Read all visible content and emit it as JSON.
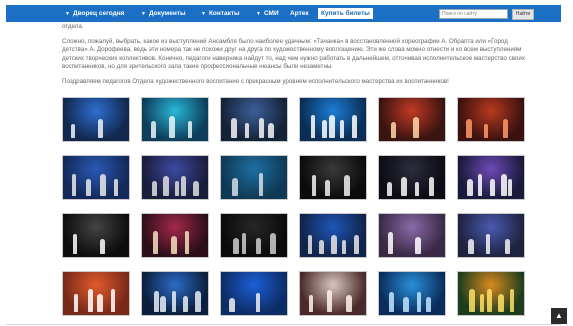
{
  "nav": {
    "items": [
      {
        "label": "Дворец сегодня",
        "has_arrow": true
      },
      {
        "label": "Документы",
        "has_arrow": true
      },
      {
        "label": "Контакты",
        "has_arrow": true
      },
      {
        "label": "СМИ",
        "has_arrow": true
      },
      {
        "label": "Артек",
        "has_arrow": false
      }
    ],
    "buy_button": "Купить билеты",
    "search_placeholder": "Поиск по сайту",
    "search_button": "Найти"
  },
  "article": {
    "p0": "отдела.",
    "p1": "Сложно, пожалуй, выбрать, какое из выступлений Ансамбля было наиболее удачным: «Тачанка» в восстановленной хореографии А. Обрапта или «Город детства» А. Дорофеева, ведь эти номера так не похожи друг на друга по художественному воплощению. Эти же слова можно отнести и ко всем выступлениям детских творческих коллективов. Конечно, педагоги наверняка найдут то, над чем нужно работать в дальнейшем, отточивая исполнительское мастерство своих воспитанников, но для зрительского зала такие профессиональные нюансы были незаметны.",
    "p2": "Поздравляем педагогов Отдела художественного воспитания с прекрасным уровнем исполнительского мастерства их воспитанников!"
  },
  "gallery": {
    "photos": [
      {
        "bg": "#12284f",
        "accent": "#2f6fd1",
        "fig": "#f0f3fa"
      },
      {
        "bg": "#0d3e5c",
        "accent": "#2ab7d6",
        "fig": "#eaf4f8"
      },
      {
        "bg": "#142238",
        "accent": "#3d5f99",
        "fig": "#f5f5f5"
      },
      {
        "bg": "#0a2e56",
        "accent": "#1c7ed6",
        "fig": "#ffffff"
      },
      {
        "bg": "#3a1410",
        "accent": "#c23a25",
        "fig": "#ffd9a8"
      },
      {
        "bg": "#3b120f",
        "accent": "#b8391f",
        "fig": "#ff9a66"
      },
      {
        "bg": "#14295a",
        "accent": "#2a59b5",
        "fig": "#e9e9e9"
      },
      {
        "bg": "#1a1d3c",
        "accent": "#3e4aa1",
        "fig": "#e0e0e0"
      },
      {
        "bg": "#0f3a55",
        "accent": "#1e6fa3",
        "fig": "#d7dde6"
      },
      {
        "bg": "#0b0b0b",
        "accent": "#3a3a3a",
        "fig": "#f2f2f2"
      },
      {
        "bg": "#0c0c14",
        "accent": "#2d2d3d",
        "fig": "#fafafa"
      },
      {
        "bg": "#1a1a3a",
        "accent": "#6e4ab8",
        "fig": "#ffffff"
      },
      {
        "bg": "#0d0d0d",
        "accent": "#444444",
        "fig": "#ffffff"
      },
      {
        "bg": "#2d0f1a",
        "accent": "#a3284a",
        "fig": "#f5e0c0"
      },
      {
        "bg": "#0b0b0b",
        "accent": "#262626",
        "fig": "#cfcfcf"
      },
      {
        "bg": "#10244a",
        "accent": "#1f56b8",
        "fig": "#e6e6e6"
      },
      {
        "bg": "#3a2a46",
        "accent": "#8a6aa8",
        "fig": "#ffffff"
      },
      {
        "bg": "#1f2340",
        "accent": "#4a5ab0",
        "fig": "#f5f5f5"
      },
      {
        "bg": "#7a2a1a",
        "accent": "#e05a2a",
        "fig": "#ffffff"
      },
      {
        "bg": "#0c1f3d",
        "accent": "#2c6bc7",
        "fig": "#e8eef6"
      },
      {
        "bg": "#0d2d66",
        "accent": "#1c5ed6",
        "fig": "#f0f0f0"
      },
      {
        "bg": "#4a2a2a",
        "accent": "#d9c7c0",
        "fig": "#fff4ea"
      },
      {
        "bg": "#0a2d5c",
        "accent": "#2a8fd9",
        "fig": "#bfe6ff"
      },
      {
        "bg": "#1e3d1e",
        "accent": "#d98a1e",
        "fig": "#ffe066"
      }
    ]
  },
  "scroll_top_icon": "arrow-up-icon"
}
